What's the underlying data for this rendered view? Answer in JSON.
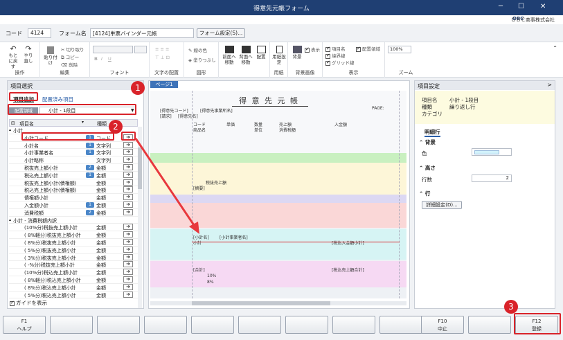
{
  "window": {
    "title": "得意先元帳フォーム",
    "company": "ＯＢＣ商事株式会社",
    "logo": "OBC"
  },
  "header": {
    "code_label": "コード",
    "code_value": "4124",
    "form_label": "フォーム名",
    "form_value": "[4124]単票バインダー元帳",
    "settings_button": "フォーム設定(S)..."
  },
  "ribbon": {
    "groups": [
      "操作",
      "編集",
      "フォント",
      "文字の配置",
      "図形",
      "用紙",
      "背景画像",
      "表示",
      "ズーム"
    ],
    "undo": "もとに戻す",
    "redo": "やり直し",
    "paste": "貼り付け",
    "cut": "切り取り",
    "copy": "コピー",
    "delete": "削除",
    "line_color": "線の色",
    "fill_color": "塗りつぶし",
    "front": "前面へ移動",
    "back": "背面へ移動",
    "arrange": "配置",
    "paper_settings": "用紙設定",
    "background": "背景",
    "show": "表示",
    "chk_item_name": "項目名",
    "chk_border": "境界線",
    "chk_grid": "グリッド線",
    "chk_area": "配置領域",
    "zoom": "100%"
  },
  "left": {
    "title": "項目選択",
    "tab_add": "項目追加",
    "tab_placed": "配置済み項目",
    "area_label": "配置領域",
    "area_value": "小計 - 1段目",
    "col_name": "項目名",
    "col_kind": "種類",
    "rows": [
      {
        "name": "小計",
        "num": "",
        "kind": "",
        "group": true
      },
      {
        "name": "小計コード",
        "num": "1",
        "kind": "コード"
      },
      {
        "name": "小計名",
        "num": "1",
        "kind": "文字列"
      },
      {
        "name": "小計事業者名",
        "num": "1",
        "kind": "文字列"
      },
      {
        "name": "小計略称",
        "num": "",
        "kind": "文字列"
      },
      {
        "name": "税抜売上額小計",
        "num": "2",
        "kind": "金額"
      },
      {
        "name": "税込売上額小計",
        "num": "1",
        "kind": "金額"
      },
      {
        "name": "税抜売上額小計(債権額)",
        "num": "",
        "kind": "金額"
      },
      {
        "name": "税込売上額小計(債権額)",
        "num": "",
        "kind": "金額"
      },
      {
        "name": "債権額小計",
        "num": "",
        "kind": "金額"
      },
      {
        "name": "入金額小計",
        "num": "1",
        "kind": "金額"
      },
      {
        "name": "消費税額",
        "num": "2",
        "kind": "金額"
      },
      {
        "name": "小計 - 消費税額内訳",
        "num": "",
        "kind": "",
        "group": true
      },
      {
        "name": "(10%分)税抜売上額小計",
        "num": "",
        "kind": "金額"
      },
      {
        "name": "( 8%軽分)税抜売上額小計",
        "num": "",
        "kind": "金額"
      },
      {
        "name": "( 8%分)税抜売上額小計",
        "num": "",
        "kind": "金額"
      },
      {
        "name": "( 5%分)税抜売上額小計",
        "num": "",
        "kind": "金額"
      },
      {
        "name": "( 3%分)税抜売上額小計",
        "num": "",
        "kind": "金額"
      },
      {
        "name": "( -%分)税抜売上額小計",
        "num": "",
        "kind": "金額"
      },
      {
        "name": "(10%分)税込売上額小計",
        "num": "",
        "kind": "金額"
      },
      {
        "name": "( 8%軽分)税込売上額小計",
        "num": "",
        "kind": "金額"
      },
      {
        "name": "( 8%分)税込売上額小計",
        "num": "",
        "kind": "金額"
      },
      {
        "name": "( 5%分)税込売上額小計",
        "num": "",
        "kind": "金額"
      }
    ],
    "guide": "ガイドを表示"
  },
  "canvas": {
    "page_tab": "ページ1",
    "form_title": "得 意 先 元 帳",
    "page_label": "PAGE:",
    "labels": [
      "[得意先コード]",
      "[得意先事業所名]",
      "[請求]",
      "[得意先名]",
      "コード",
      "単価",
      "数量",
      "売上額",
      "入金額",
      "商品名",
      "単位",
      "消費税額",
      "[摘要]",
      "税抜売上額",
      "[合計]",
      "10%",
      "8%",
      "[小計名]",
      "[小計事業者名]",
      "小計",
      "[税込入金額小計]",
      "[税込売上額合計]"
    ]
  },
  "right": {
    "title": "項目設定",
    "item_label": "項目名",
    "item_value": "小計 - 1段目",
    "kind_label": "種類",
    "kind_value": "繰り返し行",
    "category_label": "カテゴリ",
    "tab": "明細行",
    "sec_bg": "背景",
    "color_label": "色",
    "sec_height": "高さ",
    "rows_label": "行数",
    "rows_value": "2",
    "sec_row": "行",
    "detail_button": "詳細設定(D)..."
  },
  "fkeys": [
    {
      "key": "F1",
      "label": "ヘルプ"
    },
    {
      "key": "",
      "label": ""
    },
    {
      "key": "",
      "label": ""
    },
    {
      "key": "",
      "label": ""
    },
    {
      "key": "",
      "label": ""
    },
    {
      "key": "",
      "label": ""
    },
    {
      "key": "",
      "label": ""
    },
    {
      "key": "",
      "label": ""
    },
    {
      "key": "",
      "label": ""
    },
    {
      "key": "F10",
      "label": "中止"
    },
    {
      "key": "",
      "label": ""
    },
    {
      "key": "F12",
      "label": "登録"
    }
  ],
  "callouts": [
    "1",
    "2",
    "3"
  ],
  "colors": {
    "title_bar": "#1f3f73",
    "accent": "#d9232a",
    "selection": "#4a86c8"
  }
}
